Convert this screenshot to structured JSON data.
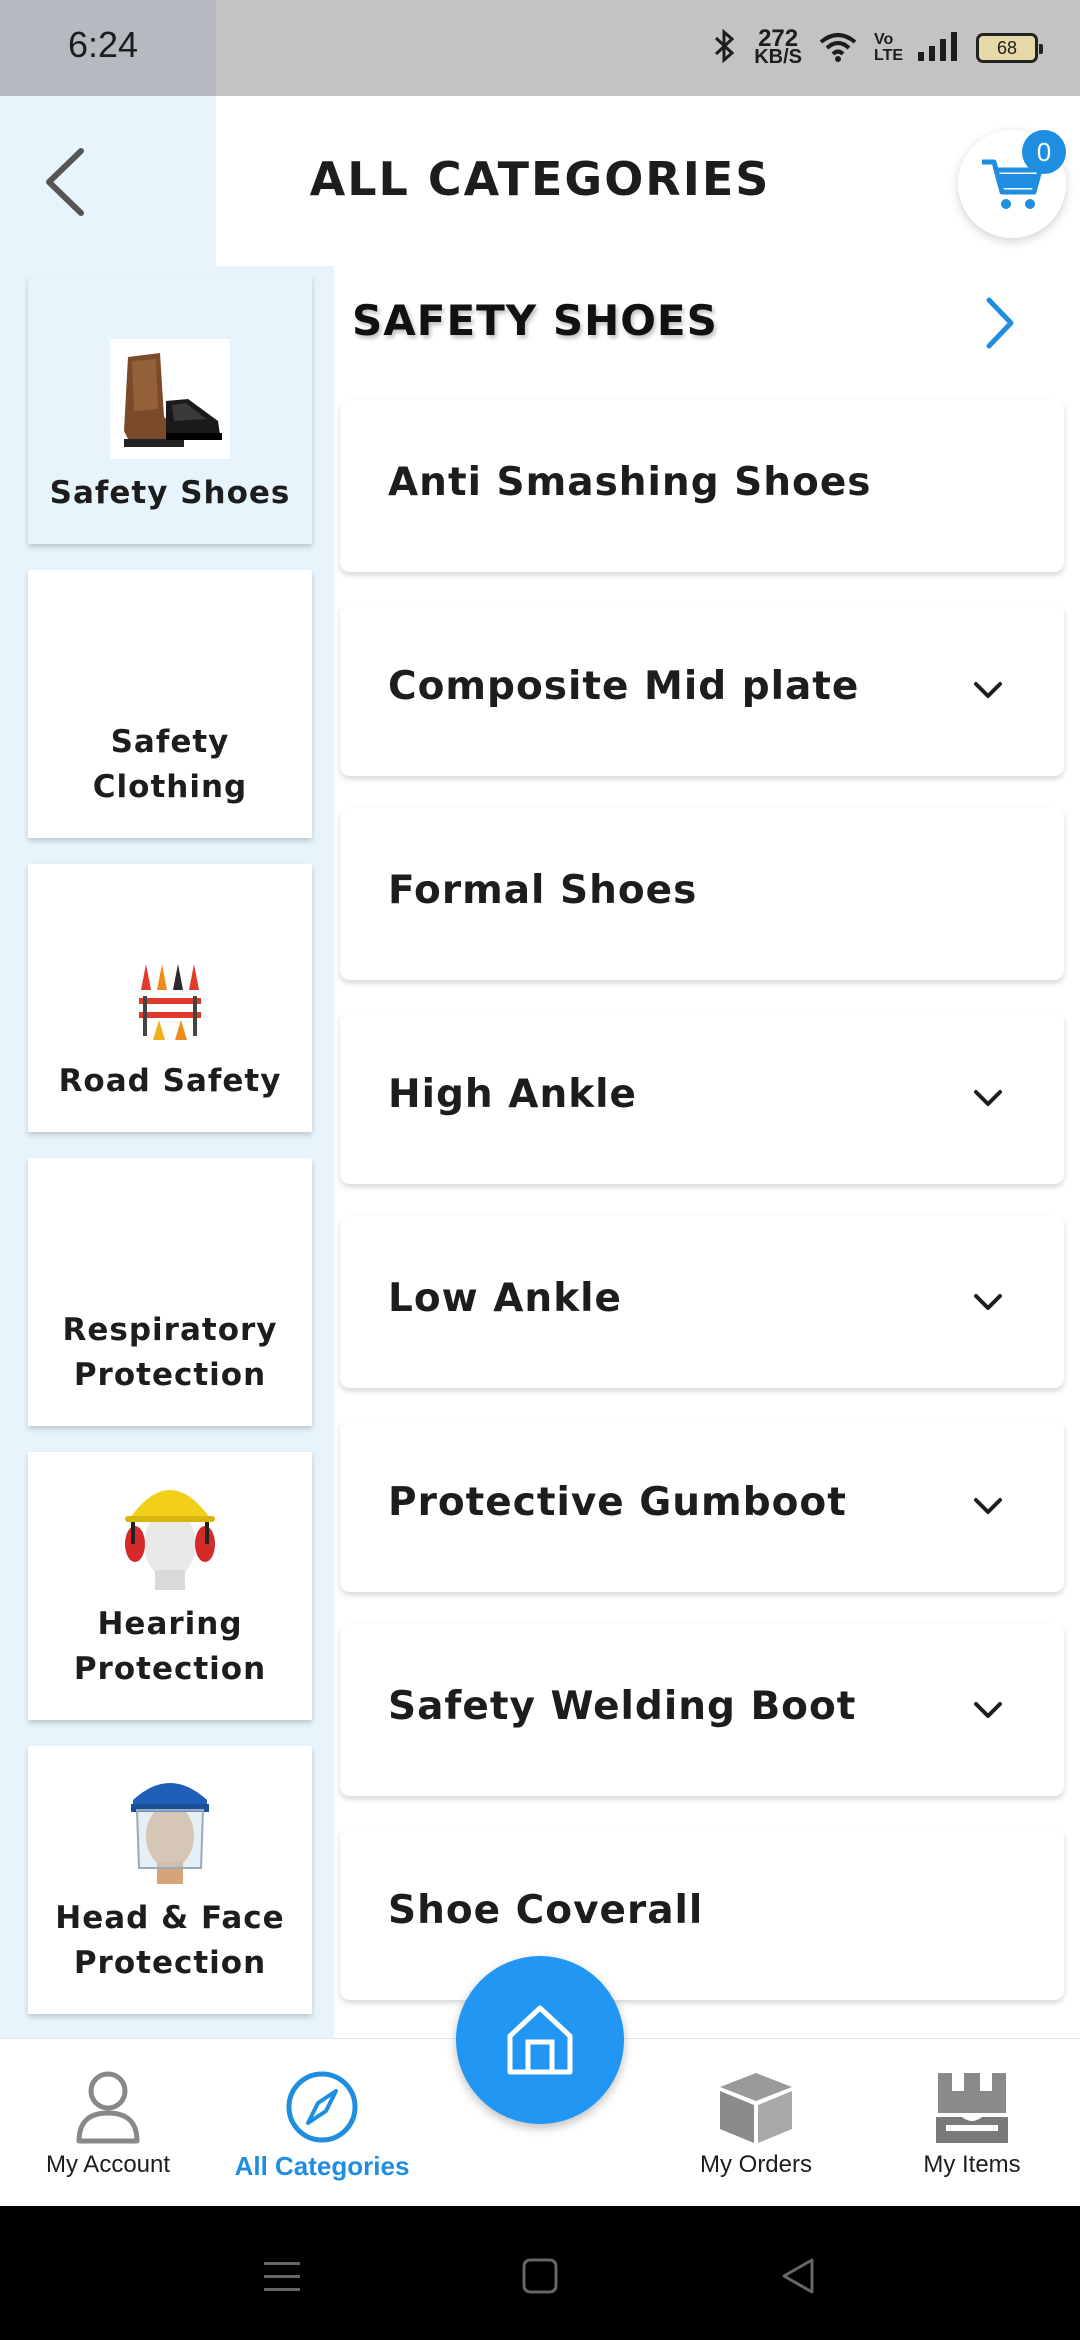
{
  "status_bar": {
    "time": "6:24",
    "net_speed_value": "272",
    "net_speed_unit": "KB/S",
    "volte": "Vo LTE",
    "battery": "68",
    "icons": [
      "bluetooth-icon",
      "wifi-icon",
      "signal-icon",
      "battery-icon"
    ]
  },
  "header": {
    "title": "ALL CATEGORIES",
    "cart_count": "0"
  },
  "sidebar": {
    "items": [
      {
        "label": "Safety Shoes",
        "icon": "boots-icon",
        "active": true
      },
      {
        "label": "Safety Clothing",
        "icon": "",
        "active": false
      },
      {
        "label": "Road Safety",
        "icon": "traffic-cones-icon",
        "active": false
      },
      {
        "label": "Respiratory Protection",
        "icon": "",
        "active": false
      },
      {
        "label": "Hearing Protection",
        "icon": "helmet-earmuff-icon",
        "active": false
      },
      {
        "label": "Head & Face Protection",
        "icon": "face-shield-icon",
        "active": false
      }
    ]
  },
  "main": {
    "section_title": "SAFETY SHOES",
    "subcategories": [
      {
        "label": "Anti Smashing Shoes",
        "expandable": false
      },
      {
        "label": "Composite Mid plate",
        "expandable": true
      },
      {
        "label": "Formal Shoes",
        "expandable": false
      },
      {
        "label": "High Ankle",
        "expandable": true
      },
      {
        "label": "Low Ankle",
        "expandable": true
      },
      {
        "label": "Protective Gumboot",
        "expandable": true
      },
      {
        "label": "Safety Welding Boot",
        "expandable": true
      },
      {
        "label": "Shoe Coverall",
        "expandable": false
      }
    ]
  },
  "bottom_nav": {
    "items": [
      {
        "label": "My Account",
        "icon": "user-icon"
      },
      {
        "label": "All Categories",
        "icon": "compass-icon",
        "active": true
      },
      {
        "label": "My Orders",
        "icon": "box-icon"
      },
      {
        "label": "My Items",
        "icon": "items-icon"
      }
    ],
    "home_icon": "home-icon"
  },
  "colors": {
    "accent": "#1f8ee0",
    "fab": "#2196f3",
    "sidebar_bg": "#e7f4fc"
  }
}
